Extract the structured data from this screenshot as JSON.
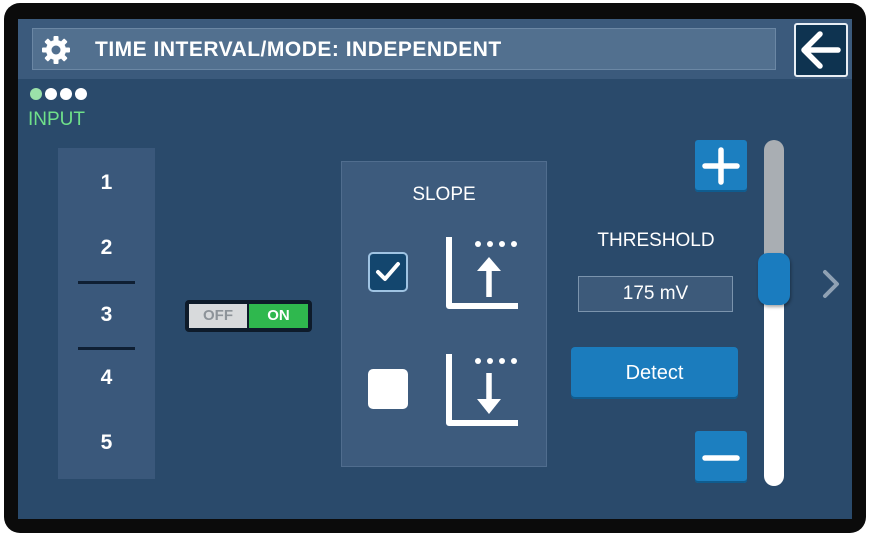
{
  "header": {
    "title": "TIME INTERVAL/MODE: INDEPENDENT",
    "settings_icon": "gear-icon",
    "back_icon": "arrow-left-icon"
  },
  "page_indicator": {
    "total": 4,
    "active_index": 0
  },
  "input": {
    "label": "INPUT",
    "channels": [
      "1",
      "2",
      "3",
      "4",
      "5"
    ],
    "selected": "3"
  },
  "toggle": {
    "off_label": "OFF",
    "on_label": "ON",
    "state": "ON"
  },
  "slope": {
    "label": "SLOPE",
    "options": [
      {
        "name": "rising",
        "icon": "rising-slope-icon",
        "checked": true
      },
      {
        "name": "falling",
        "icon": "falling-slope-icon",
        "checked": false
      }
    ]
  },
  "threshold": {
    "label": "THRESHOLD",
    "value": "175 mV",
    "detect_label": "Detect",
    "plus_icon": "plus-icon",
    "minus_icon": "minus-icon",
    "slider_level": 0.45
  },
  "colors": {
    "background": "#2a4a6b",
    "header": "#3b5a7c",
    "accent": "#1c7fc0",
    "input_green": "#6fe08a",
    "toggle_on": "#2fb84e"
  },
  "nav": {
    "next_icon": "chevron-right-icon"
  }
}
